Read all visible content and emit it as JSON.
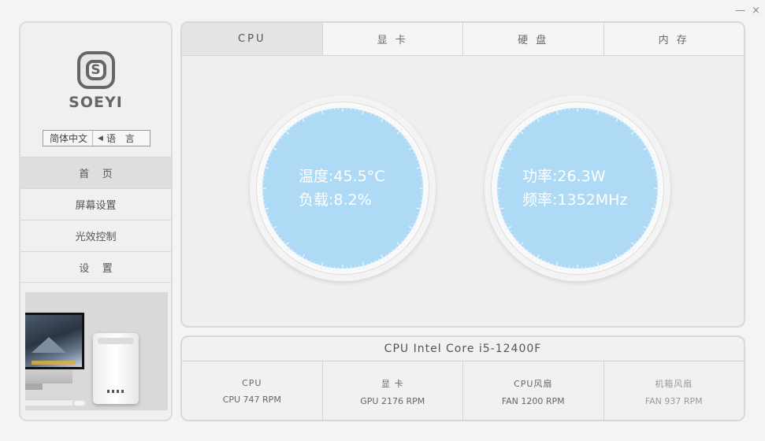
{
  "window": {
    "minimize_label": "—",
    "close_label": "×"
  },
  "brand": {
    "logo_letter": "S",
    "name": "SOEYI"
  },
  "language": {
    "current": "简体中文",
    "arrow": "◀",
    "label": "语 言"
  },
  "nav": {
    "items": [
      {
        "label": "首    页",
        "active": true
      },
      {
        "label": "屏幕设置",
        "active": false
      },
      {
        "label": "光效控制",
        "active": false
      },
      {
        "label": "设    置",
        "active": false
      }
    ]
  },
  "tabs": [
    {
      "label": "CPU",
      "active": true
    },
    {
      "label": "显 卡",
      "active": false
    },
    {
      "label": "硬 盘",
      "active": false
    },
    {
      "label": "内 存",
      "active": false
    }
  ],
  "gauges": {
    "left": {
      "line1": "温度:45.5°C",
      "line2": "负载:8.2%"
    },
    "right": {
      "line1": "功率:26.3W",
      "line2": "频率:1352MHz"
    }
  },
  "colors": {
    "gauge_face": "#afdaf5",
    "panel_bg": "#efefef",
    "border": "#d8d8d8"
  },
  "cpu_model": "CPU Intel Core i5-12400F",
  "fans": [
    {
      "name": "CPU",
      "value": "CPU 747 RPM"
    },
    {
      "name": "显 卡",
      "value": "GPU 2176 RPM"
    },
    {
      "name": "CPU风扇",
      "value": "FAN 1200 RPM"
    },
    {
      "name": "机箱风扇",
      "value": "FAN 937 RPM"
    }
  ]
}
